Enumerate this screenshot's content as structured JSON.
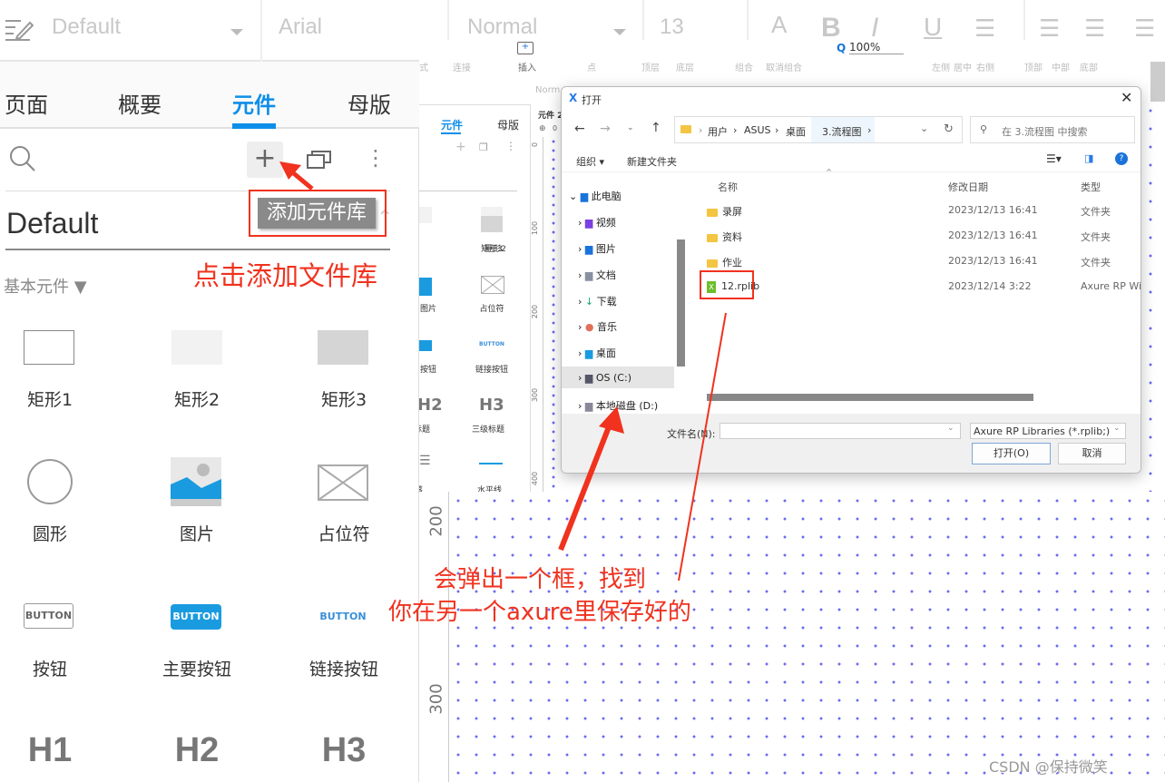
{
  "toolbar": {
    "style": "Default",
    "font": "Arial",
    "weight": "Normal",
    "size": "13",
    "zoom": "100%",
    "small_labels": [
      "式",
      "连接",
      "插入",
      "点",
      "顶层",
      "底层",
      "组合",
      "取消组合",
      "左侧",
      "居中",
      "右侧",
      "顶部",
      "中部",
      "底部"
    ],
    "small_font": "Arial",
    "small_weight": "Norm"
  },
  "left_panel": {
    "tabs": [
      "页面",
      "概要",
      "元件",
      "母版"
    ],
    "active_tab": "元件",
    "library": "Default",
    "tooltip": "添加元件库",
    "category": "基本元件 ▼",
    "widgets": [
      "矩形1",
      "矩形2",
      "矩形3",
      "圆形",
      "图片",
      "占位符",
      "按钮",
      "主要按钮",
      "链接按钮",
      "H1",
      "H2",
      "H3"
    ],
    "button_text": "BUTTON"
  },
  "mid_panel": {
    "tabs": [
      "元件",
      "母版"
    ],
    "page_tab": "元件 2",
    "ruler": [
      "0",
      "100",
      "200",
      "300",
      "400"
    ],
    "ruler_top": "0",
    "widgets": [
      "矩形2",
      "矩形3",
      "图片",
      "占位符",
      "按钮",
      "链接按钮",
      "H2",
      "H3",
      "标题",
      "三级标题",
      "段落",
      "水平线"
    ],
    "button_text": "BUTTON"
  },
  "canvas": {
    "ruler": [
      "200",
      "300"
    ]
  },
  "dialog": {
    "title": "打开",
    "path": [
      "用户",
      "ASUS",
      "桌面",
      "3.流程图"
    ],
    "search_placeholder": "在 3.流程图 中搜索",
    "organize": "组织 ▾",
    "new_folder": "新建文件夹",
    "tree": [
      "此电脑",
      "视频",
      "图片",
      "文档",
      "下载",
      "音乐",
      "桌面",
      "OS (C:)",
      "本地磁盘 (D:)"
    ],
    "columns": [
      "名称",
      "修改日期",
      "类型"
    ],
    "files": [
      {
        "name": "录屏",
        "date": "2023/12/13 16:41",
        "type": "文件夹"
      },
      {
        "name": "资料",
        "date": "2023/12/13 16:41",
        "type": "文件夹"
      },
      {
        "name": "作业",
        "date": "2023/12/13 16:41",
        "type": "文件夹"
      },
      {
        "name": "12.rplib",
        "date": "2023/12/14 3:22",
        "type": "Axure RP Wi"
      }
    ],
    "filename_label": "文件名(N):",
    "filename": "",
    "filter": "Axure RP Libraries (*.rplib;)",
    "open": "打开(O)",
    "cancel": "取消"
  },
  "annotations": {
    "click_add": "点击添加文件库",
    "popup_line1": "会弹出一个框，找到",
    "popup_line2": "你在另一个axure里保存好的"
  },
  "watermark": "CSDN @保持微笑",
  "colors": {
    "accent": "#0e8ee9",
    "annotation": "#f0321e",
    "grid_dot": "#6b6bf0"
  }
}
